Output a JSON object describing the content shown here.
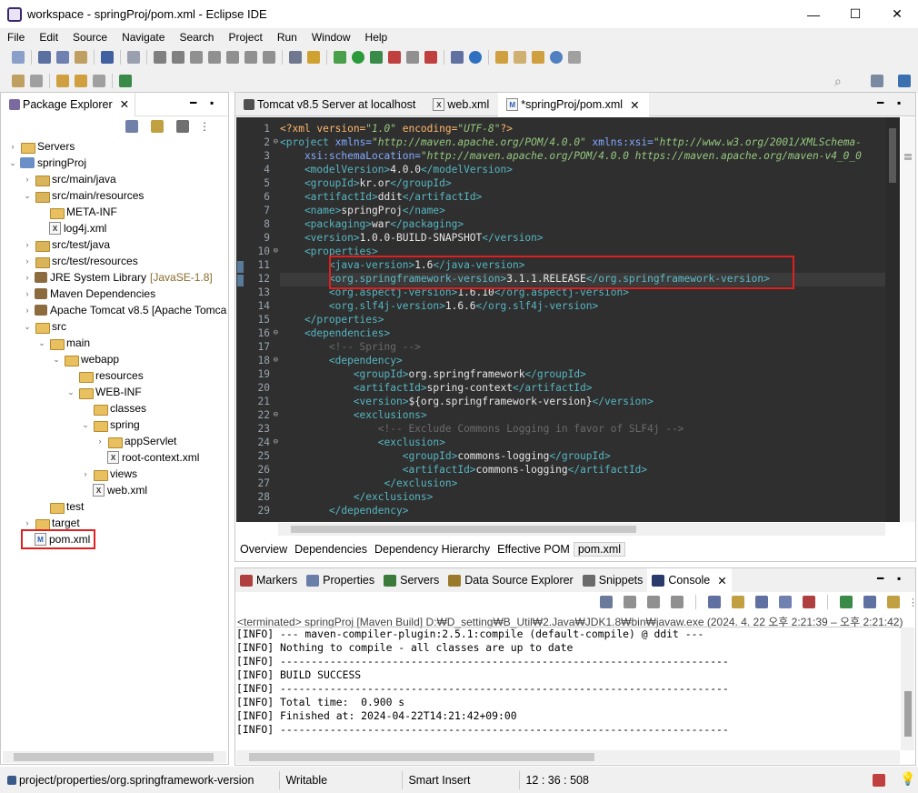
{
  "window": {
    "title": "workspace - springProj/pom.xml - Eclipse IDE",
    "minimize_glyph": "—",
    "maximize_glyph": "☐",
    "close_glyph": "✕"
  },
  "menu": [
    "File",
    "Edit",
    "Source",
    "Navigate",
    "Search",
    "Project",
    "Run",
    "Window",
    "Help"
  ],
  "package_explorer": {
    "tab_label": "Package Explorer",
    "tree": [
      {
        "label": "Servers",
        "level": 0,
        "arrow": "›",
        "icon": "folder"
      },
      {
        "label": "springProj",
        "level": 0,
        "arrow": "⌄",
        "icon": "project"
      },
      {
        "label": "src/main/java",
        "level": 1,
        "arrow": "›",
        "icon": "package-folder"
      },
      {
        "label": "src/main/resources",
        "level": 1,
        "arrow": "⌄",
        "icon": "package-folder"
      },
      {
        "label": "META-INF",
        "level": 2,
        "arrow": "",
        "icon": "folder"
      },
      {
        "label": "log4j.xml",
        "level": 2,
        "arrow": "",
        "icon": "xml-file"
      },
      {
        "label": "src/test/java",
        "level": 1,
        "arrow": "›",
        "icon": "package-folder"
      },
      {
        "label": "src/test/resources",
        "level": 1,
        "arrow": "›",
        "icon": "package-folder"
      },
      {
        "label": "JRE System Library",
        "suffix": "[JavaSE-1.8]",
        "level": 1,
        "arrow": "›",
        "icon": "library"
      },
      {
        "label": "Maven Dependencies",
        "level": 1,
        "arrow": "›",
        "icon": "library"
      },
      {
        "label": "Apache Tomcat v8.5 [Apache Tomca",
        "level": 1,
        "arrow": "›",
        "icon": "library"
      },
      {
        "label": "src",
        "level": 1,
        "arrow": "⌄",
        "icon": "folder"
      },
      {
        "label": "main",
        "level": 2,
        "arrow": "⌄",
        "icon": "folder"
      },
      {
        "label": "webapp",
        "level": 3,
        "arrow": "⌄",
        "icon": "folder"
      },
      {
        "label": "resources",
        "level": 4,
        "arrow": "",
        "icon": "folder"
      },
      {
        "label": "WEB-INF",
        "level": 4,
        "arrow": "⌄",
        "icon": "folder"
      },
      {
        "label": "classes",
        "level": 5,
        "arrow": "",
        "icon": "folder"
      },
      {
        "label": "spring",
        "level": 5,
        "arrow": "⌄",
        "icon": "folder"
      },
      {
        "label": "appServlet",
        "level": 6,
        "arrow": "›",
        "icon": "folder"
      },
      {
        "label": "root-context.xml",
        "level": 6,
        "arrow": "",
        "icon": "xml-file"
      },
      {
        "label": "views",
        "level": 5,
        "arrow": "›",
        "icon": "folder"
      },
      {
        "label": "web.xml",
        "level": 5,
        "arrow": "",
        "icon": "xml-file"
      },
      {
        "label": "test",
        "level": 2,
        "arrow": "",
        "icon": "folder"
      },
      {
        "label": "target",
        "level": 1,
        "arrow": "›",
        "icon": "folder"
      },
      {
        "label": "pom.xml",
        "level": 1,
        "arrow": "",
        "icon": "maven-file",
        "highlight": true
      }
    ]
  },
  "editor": {
    "tabs": [
      {
        "label": "Tomcat v8.5 Server at localhost",
        "active": false
      },
      {
        "label": "web.xml",
        "active": false
      },
      {
        "label": "*springProj/pom.xml",
        "active": true
      }
    ],
    "lines": [
      {
        "n": "1",
        "parts": [
          [
            "pi",
            "<?xml version="
          ],
          [
            "av",
            "\"1.0\""
          ],
          [
            "pi",
            " encoding="
          ],
          [
            "av",
            "\"UTF-8\""
          ],
          [
            "pi",
            "?>"
          ]
        ]
      },
      {
        "n": "2",
        "fold": true,
        "parts": [
          [
            "t",
            "<project "
          ],
          [
            "at",
            "xmlns="
          ],
          [
            "av",
            "\"http://maven.apache.org/POM/4.0.0\""
          ],
          [
            "at",
            " xmlns:xsi="
          ],
          [
            "av",
            "\"http://www.w3.org/2001/XMLSchema-"
          ]
        ]
      },
      {
        "n": "3",
        "parts": [
          [
            "at",
            "    xsi:schemaLocation="
          ],
          [
            "av",
            "\"http://maven.apache.org/POM/4.0.0 https://maven.apache.org/maven-v4_0_0"
          ]
        ]
      },
      {
        "n": "4",
        "parts": [
          [
            "t",
            "    <modelVersion>"
          ],
          [
            "tx",
            "4.0.0"
          ],
          [
            "t",
            "</modelVersion>"
          ]
        ]
      },
      {
        "n": "5",
        "parts": [
          [
            "t",
            "    <groupId>"
          ],
          [
            "tx",
            "kr.or"
          ],
          [
            "t",
            "</groupId>"
          ]
        ]
      },
      {
        "n": "6",
        "parts": [
          [
            "t",
            "    <artifactId>"
          ],
          [
            "tx",
            "ddit"
          ],
          [
            "t",
            "</artifactId>"
          ]
        ]
      },
      {
        "n": "7",
        "parts": [
          [
            "t",
            "    <name>"
          ],
          [
            "tx",
            "springProj"
          ],
          [
            "t",
            "</name>"
          ]
        ]
      },
      {
        "n": "8",
        "parts": [
          [
            "t",
            "    <packaging>"
          ],
          [
            "tx",
            "war"
          ],
          [
            "t",
            "</packaging>"
          ]
        ]
      },
      {
        "n": "9",
        "parts": [
          [
            "t",
            "    <version>"
          ],
          [
            "tx",
            "1.0.0-BUILD-SNAPSHOT"
          ],
          [
            "t",
            "</version>"
          ]
        ]
      },
      {
        "n": "10",
        "fold": true,
        "parts": [
          [
            "t",
            "    <properties>"
          ]
        ]
      },
      {
        "n": "11",
        "parts": [
          [
            "t",
            "        <java-version>"
          ],
          [
            "tx",
            "1.6"
          ],
          [
            "t",
            "</java-version>"
          ]
        ]
      },
      {
        "n": "12",
        "parts": [
          [
            "t",
            "        <org.springframework-version>"
          ],
          [
            "tx",
            "3.1.1.RELEASE"
          ],
          [
            "t",
            "</org.springframework-version>"
          ]
        ]
      },
      {
        "n": "13",
        "parts": [
          [
            "t",
            "        <org.aspectj-version>"
          ],
          [
            "tx",
            "1.6.10"
          ],
          [
            "t",
            "</org.aspectj-version>"
          ]
        ]
      },
      {
        "n": "14",
        "parts": [
          [
            "t",
            "        <org.slf4j-version>"
          ],
          [
            "tx",
            "1.6.6"
          ],
          [
            "t",
            "</org.slf4j-version>"
          ]
        ]
      },
      {
        "n": "15",
        "parts": [
          [
            "t",
            "    </properties>"
          ]
        ]
      },
      {
        "n": "16",
        "fold": true,
        "parts": [
          [
            "t",
            "    <dependencies>"
          ]
        ]
      },
      {
        "n": "17",
        "parts": [
          [
            "cm",
            "        <!-- Spring -->"
          ]
        ]
      },
      {
        "n": "18",
        "fold": true,
        "parts": [
          [
            "t",
            "        <dependency>"
          ]
        ]
      },
      {
        "n": "19",
        "parts": [
          [
            "t",
            "            <groupId>"
          ],
          [
            "tx",
            "org.springframework"
          ],
          [
            "t",
            "</groupId>"
          ]
        ]
      },
      {
        "n": "20",
        "parts": [
          [
            "t",
            "            <artifactId>"
          ],
          [
            "tx",
            "spring-context"
          ],
          [
            "t",
            "</artifactId>"
          ]
        ]
      },
      {
        "n": "21",
        "parts": [
          [
            "t",
            "            <version>"
          ],
          [
            "tx",
            "${org.springframework-version}"
          ],
          [
            "t",
            "</version>"
          ]
        ]
      },
      {
        "n": "22",
        "fold": true,
        "parts": [
          [
            "t",
            "            <exclusions>"
          ]
        ]
      },
      {
        "n": "23",
        "parts": [
          [
            "cm",
            "                <!-- Exclude Commons Logging in favor of SLF4j -->"
          ]
        ]
      },
      {
        "n": "24",
        "fold": true,
        "parts": [
          [
            "t",
            "                <exclusion>"
          ]
        ]
      },
      {
        "n": "25",
        "parts": [
          [
            "t",
            "                    <groupId>"
          ],
          [
            "tx",
            "commons-logging"
          ],
          [
            "t",
            "</groupId>"
          ]
        ]
      },
      {
        "n": "26",
        "parts": [
          [
            "t",
            "                    <artifactId>"
          ],
          [
            "tx",
            "commons-logging"
          ],
          [
            "t",
            "</artifactId>"
          ]
        ]
      },
      {
        "n": "27",
        "parts": [
          [
            "t",
            "                 </exclusion>"
          ]
        ]
      },
      {
        "n": "28",
        "parts": [
          [
            "t",
            "            </exclusions>"
          ]
        ]
      },
      {
        "n": "29",
        "parts": [
          [
            "t",
            "        </dependency>"
          ]
        ]
      }
    ],
    "pom_tabs": [
      "Overview",
      "Dependencies",
      "Dependency Hierarchy",
      "Effective POM",
      "pom.xml"
    ]
  },
  "bottom_panel": {
    "tabs": [
      {
        "label": "Markers",
        "icon": "markers-icon",
        "color": "#b04040"
      },
      {
        "label": "Properties",
        "icon": "properties-icon",
        "color": "#6a7fa8"
      },
      {
        "label": "Servers",
        "icon": "servers-icon",
        "color": "#3a7a3a"
      },
      {
        "label": "Data Source Explorer",
        "icon": "data-source-icon",
        "color": "#9a7a2a"
      },
      {
        "label": "Snippets",
        "icon": "snippets-icon",
        "color": "#6a6a6a"
      },
      {
        "label": "Console",
        "icon": "console-icon",
        "color": "#2a3a6a",
        "active": true
      }
    ],
    "console_status": "<terminated> springProj [Maven Build] D:₩D_setting₩B_Util₩2.Java₩JDK1.8₩bin₩javaw.exe  (2024. 4. 22 오후 2:21:39 – 오후 2:21:42)",
    "console_lines": [
      "[INFO] --- maven-compiler-plugin:2.5.1:compile (default-compile) @ ddit ---",
      "[INFO] Nothing to compile - all classes are up to date",
      "[INFO] ------------------------------------------------------------------------",
      "[INFO] BUILD SUCCESS",
      "[INFO] ------------------------------------------------------------------------",
      "[INFO] Total time:  0.900 s",
      "[INFO] Finished at: 2024-04-22T14:21:42+09:00",
      "[INFO] ------------------------------------------------------------------------"
    ]
  },
  "status_bar": {
    "path": "project/properties/org.springframework-version",
    "writable": "Writable",
    "insert_mode": "Smart Insert",
    "position": "12 : 36 : 508"
  }
}
